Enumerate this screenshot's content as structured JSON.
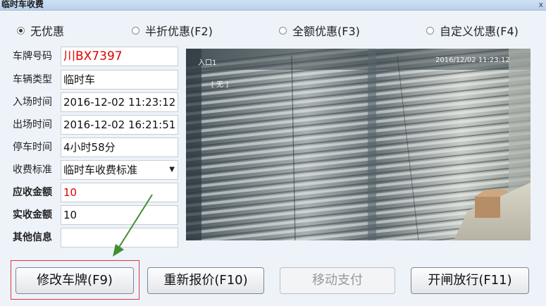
{
  "window": {
    "title": "临时车收费",
    "close_glyph": "x"
  },
  "discount": {
    "options": [
      {
        "label": "无优惠",
        "selected": true
      },
      {
        "label": "半折优惠(F2)",
        "selected": false
      },
      {
        "label": "全额优惠(F3)",
        "selected": false
      },
      {
        "label": "自定义优惠(F4)",
        "selected": false
      }
    ]
  },
  "form": {
    "plate": {
      "label": "车牌号码",
      "value": "川BX7397"
    },
    "vehicle_type": {
      "label": "车辆类型",
      "value": "临时车"
    },
    "entry_time": {
      "label": "入场时间",
      "value": "2016-12-02 11:23:12"
    },
    "exit_time": {
      "label": "出场时间",
      "value": "2016-12-02 16:21:51"
    },
    "parking_time": {
      "label": "停车时间",
      "value": "4小时58分"
    },
    "fee_standard": {
      "label": "收费标准",
      "value": "临时车收费标准"
    },
    "amount_due": {
      "label": "应收金额",
      "value": "10"
    },
    "amount_paid": {
      "label": "实收金额",
      "value": "10"
    },
    "other_info": {
      "label": "其他信息",
      "value": ""
    }
  },
  "camera": {
    "channel": "入口1",
    "timestamp": "2016/12/02  11:23:12",
    "tag": "[ 无 ]"
  },
  "buttons": {
    "edit_plate": "修改车牌(F9)",
    "requote": "重新报价(F10)",
    "mobile_pay": "移动支付",
    "open_gate": "开闸放行(F11)"
  },
  "colors": {
    "amount_due": "#e00000",
    "highlight_box": "#d93a3a",
    "arrow": "#3f8f2f"
  }
}
